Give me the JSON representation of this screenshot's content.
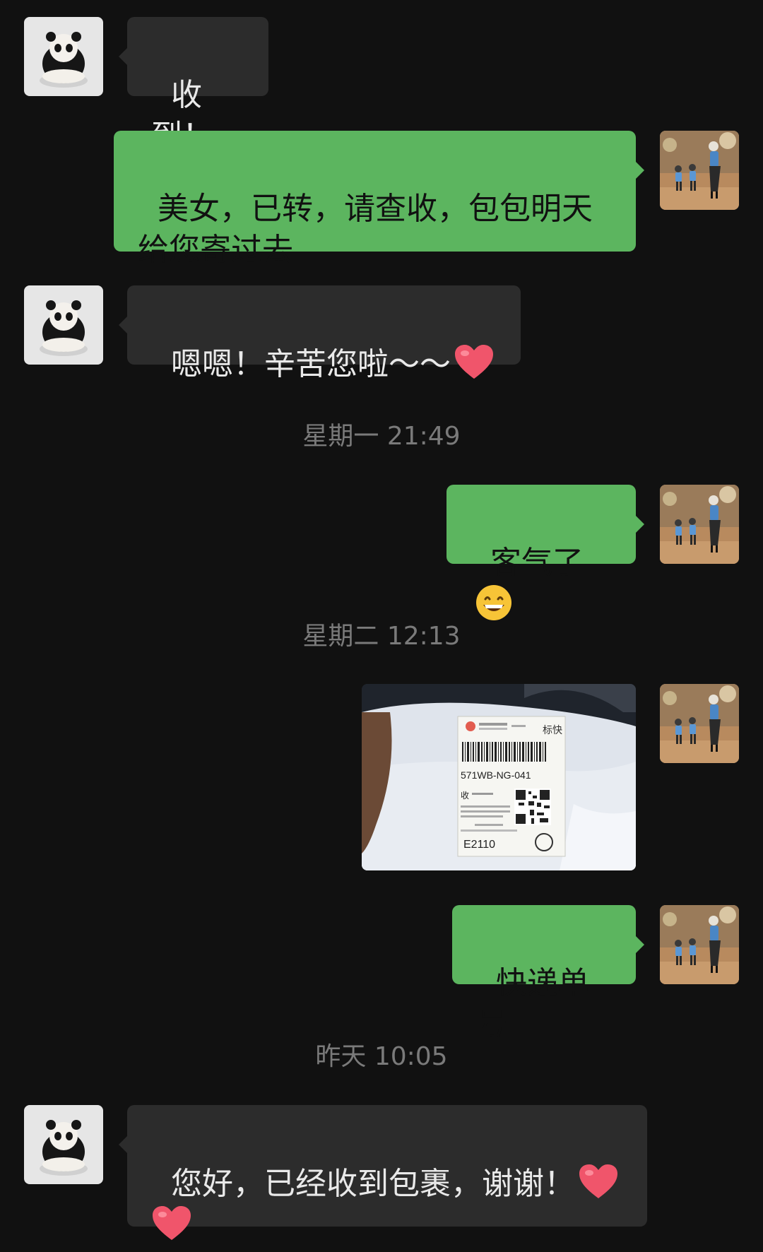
{
  "messages": [
    {
      "side": "in",
      "text": "收到！"
    },
    {
      "side": "out",
      "text": "美女，已转，请查收，包包明天给您寄过去"
    },
    {
      "side": "in",
      "text": "嗯嗯！辛苦您啦～～",
      "emoji": "heart"
    },
    {
      "side": "out",
      "text": "客气了",
      "emoji": "grin"
    },
    {
      "side": "out",
      "type": "image",
      "image": {
        "label_code": "571WB-NG-041",
        "bottom_code": "E2110",
        "tag": "标快",
        "receiver_mark": "收"
      }
    },
    {
      "side": "out",
      "text": "快递单号"
    },
    {
      "side": "in",
      "text": "您好，已经收到包裹，谢谢！",
      "emoji": "heart-heart"
    }
  ],
  "timestamps": [
    "星期一 21:49",
    "星期二 12:13",
    "昨天 10:05"
  ],
  "colors": {
    "background": "#111111",
    "incoming_bubble": "#2c2c2c",
    "outgoing_bubble": "#5cb55f",
    "timestamp_text": "#7a7a7a"
  },
  "icons": {
    "incoming_avatar": "panda-avatar-icon",
    "outgoing_avatar": "mother-children-avatar-icon",
    "heart": "heart-emoji-icon",
    "grin": "grinning-face-emoji-icon"
  }
}
